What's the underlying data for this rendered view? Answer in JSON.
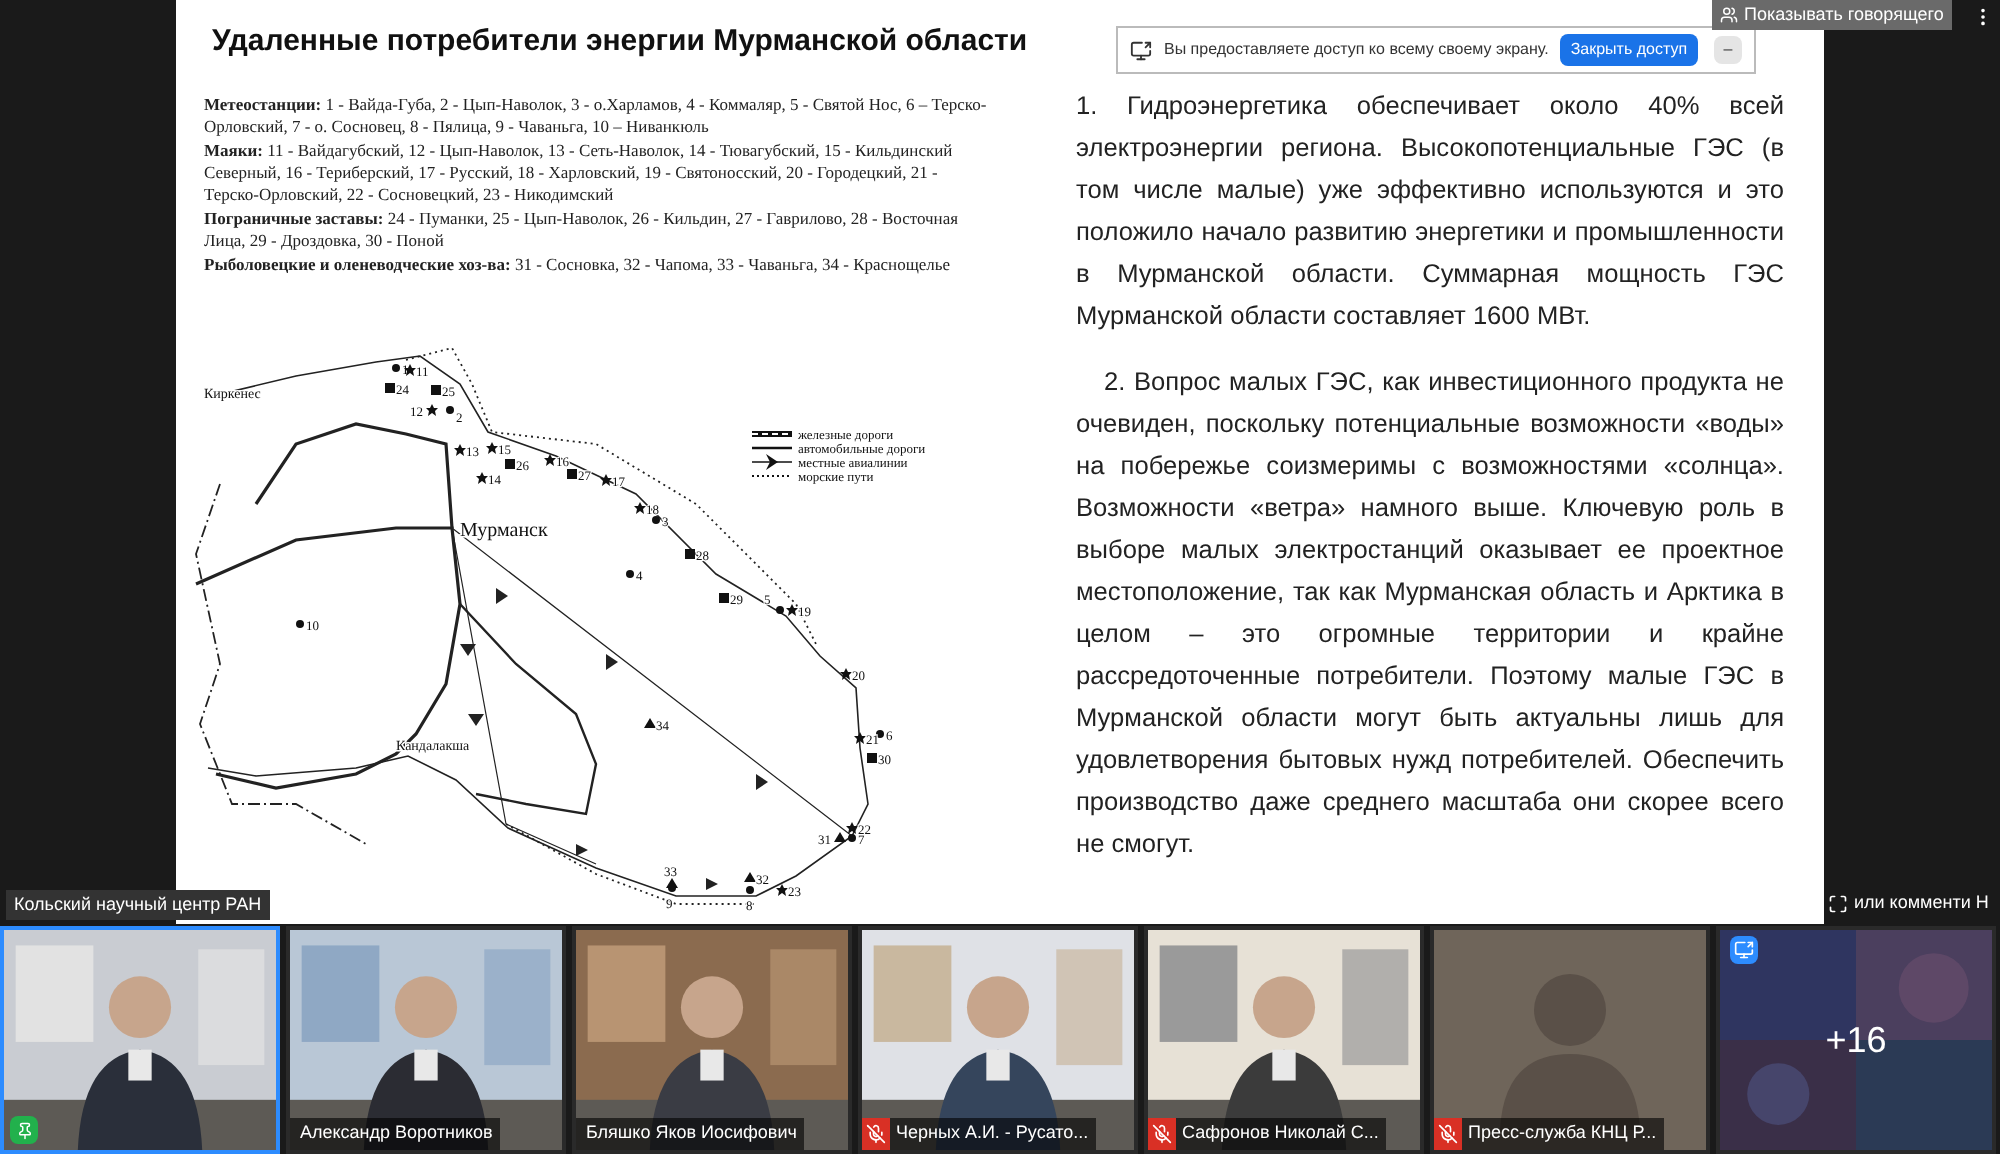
{
  "slide": {
    "title": "Удаленные потребители энергии Мурманской области",
    "legend_groups": [
      {
        "label": "Метеостанции:",
        "text": "1 - Вайда-Губа, 2 - Цып-Наволок, 3 - о.Харламов, 4 - Коммаляр, 5 - Святой Нос, 6 – Терско-Орловский, 7 - о. Сосновец, 8 - Пялица, 9 - Чаваньга, 10 – Ниванкюль"
      },
      {
        "label": "Маяки:",
        "text": "11 - Вайдагубский, 12 - Цып-Наволок, 13 - Сеть-Наволок, 14 - Тювагубский, 15 - Кильдинский Северный, 16 - Териберский, 17 - Русский, 18 - Харловский, 19 - Святоносский, 20 - Городецкий, 21 - Терско-Орловский, 22 - Сосновецкий, 23 - Никодимский"
      },
      {
        "label": "Пограничные заставы:",
        "text": "24 - Пуманки, 25 - Цып-Наволок, 26 - Кильдин, 27 - Гаврилово, 28 - Восточная Лица, 29 - Дроздовка, 30 - Поной"
      },
      {
        "label": "Рыболовецкие и оленеводческие хоз-ва:",
        "text": "31 - Сосновка, 32 - Чапома, 33 - Чаваньга, 34 - Краснощелье"
      }
    ],
    "map": {
      "cities": [
        "Киркенес",
        "Мурманск",
        "Кандалакша"
      ],
      "legend": [
        {
          "kind": "rail",
          "label": "железные дороги"
        },
        {
          "kind": "road",
          "label": "автомобильные дороги"
        },
        {
          "kind": "air",
          "label": "местные авиалинии"
        },
        {
          "kind": "sea",
          "label": "морские пути"
        }
      ],
      "points": [
        {
          "label": "1",
          "kind": "station"
        },
        {
          "label": "2",
          "kind": "station"
        },
        {
          "label": "3",
          "kind": "station"
        },
        {
          "label": "4",
          "kind": "station"
        },
        {
          "label": "5",
          "kind": "station"
        },
        {
          "label": "6",
          "kind": "station"
        },
        {
          "label": "7",
          "kind": "station"
        },
        {
          "label": "9",
          "kind": "station"
        },
        {
          "label": "8",
          "kind": "station"
        },
        {
          "label": "10",
          "kind": "station"
        },
        {
          "label": "11",
          "kind": "lighthouse"
        },
        {
          "label": "12",
          "kind": "lighthouse"
        },
        {
          "label": "13",
          "kind": "lighthouse"
        },
        {
          "label": "14",
          "kind": "lighthouse"
        },
        {
          "label": "15",
          "kind": "lighthouse"
        },
        {
          "label": "16",
          "kind": "lighthouse"
        },
        {
          "label": "17",
          "kind": "lighthouse"
        },
        {
          "label": "18",
          "kind": "lighthouse"
        },
        {
          "label": "19",
          "kind": "lighthouse"
        },
        {
          "label": "20",
          "kind": "lighthouse"
        },
        {
          "label": "21",
          "kind": "lighthouse"
        },
        {
          "label": "22",
          "kind": "lighthouse"
        },
        {
          "label": "23",
          "kind": "lighthouse"
        },
        {
          "label": "24",
          "kind": "outpost"
        },
        {
          "label": "25",
          "kind": "outpost"
        },
        {
          "label": "26",
          "kind": "outpost"
        },
        {
          "label": "27",
          "kind": "outpost"
        },
        {
          "label": "28",
          "kind": "outpost"
        },
        {
          "label": "29",
          "kind": "outpost"
        },
        {
          "label": "30",
          "kind": "outpost"
        },
        {
          "label": "31",
          "kind": "farm"
        },
        {
          "label": "32",
          "kind": "farm"
        },
        {
          "label": "33",
          "kind": "farm"
        },
        {
          "label": "34",
          "kind": "farm"
        }
      ]
    },
    "paragraphs": [
      {
        "text": "1. Гидроэнергетика обеспечивает около 40% всей электроэнергии региона. Высокопотенциальные ГЭС (в том числе малые) уже эффективно используются и это положило начало развитию энергетики и промышленности в Мурманской области. Суммарная мощность ГЭС Мурманской области составляет 1600 МВт.",
        "indent": false
      },
      {
        "text": "2. Вопрос малых ГЭС, как инвестиционного продукта не очевиден, поскольку потенциальные возможности «воды» на побережье соизмеримы с возможностями «солнца». Возможности «ветра» намного выше. Ключевую роль в выборе малых электростанций оказывает ее проектное местоположение, так как Мурманская область и Арктика в целом – это огромные территории и крайне рассредоточенные потребители. Поэтому малые ГЭС в Мурманской области могут быть актуальны лишь для удовлетворения бытовых нужд потребителей. Обеспечить производство даже среднего масштаба они скорее всего не смогут.",
        "indent": true
      }
    ]
  },
  "share_banner": {
    "message": "Вы предоставляете доступ ко всему своему экрану.",
    "stop_button": "Закрыть доступ",
    "hide_button": "–"
  },
  "speaker_view_button": "Показывать говорящего",
  "presenter_label": "Кольский научный центр РАН",
  "right_label": "или комменти Н",
  "participants": [
    {
      "kind": "video",
      "muted": false,
      "active": true
    },
    {
      "kind": "video",
      "name": "Александр Воротников",
      "muted": false,
      "active": false
    },
    {
      "kind": "video",
      "name": "Бляшко Яков Иосифович",
      "muted": false,
      "active": false
    },
    {
      "kind": "video",
      "name": "Черных А.И. - Русато...",
      "muted": true,
      "active": false
    },
    {
      "kind": "video",
      "name": "Сафронов Николай С...",
      "muted": true,
      "active": false
    },
    {
      "kind": "avatar",
      "name": "Пресс-служба КНЦ Р...",
      "muted": true,
      "active": false
    },
    {
      "kind": "overflow",
      "name": "+16",
      "active": false
    }
  ]
}
